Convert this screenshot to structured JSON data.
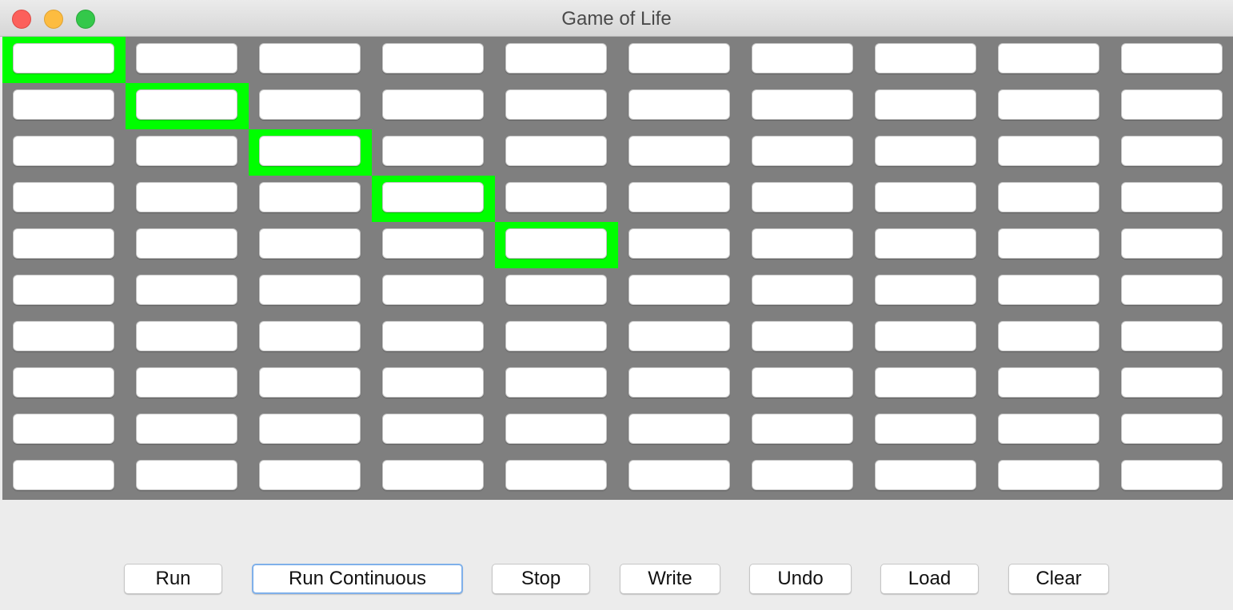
{
  "window": {
    "title": "Game of Life"
  },
  "grid": {
    "rows": 10,
    "cols": 10,
    "alive_color": "#00ff00",
    "background_color": "#7f7f7f",
    "alive_cells": [
      [
        0,
        0
      ],
      [
        1,
        1
      ],
      [
        2,
        2
      ],
      [
        3,
        3
      ],
      [
        4,
        4
      ]
    ]
  },
  "controls": {
    "run": "Run",
    "run_continuous": "Run Continuous",
    "stop": "Stop",
    "write": "Write",
    "undo": "Undo",
    "load": "Load",
    "clear": "Clear"
  },
  "focused_control": "run_continuous"
}
